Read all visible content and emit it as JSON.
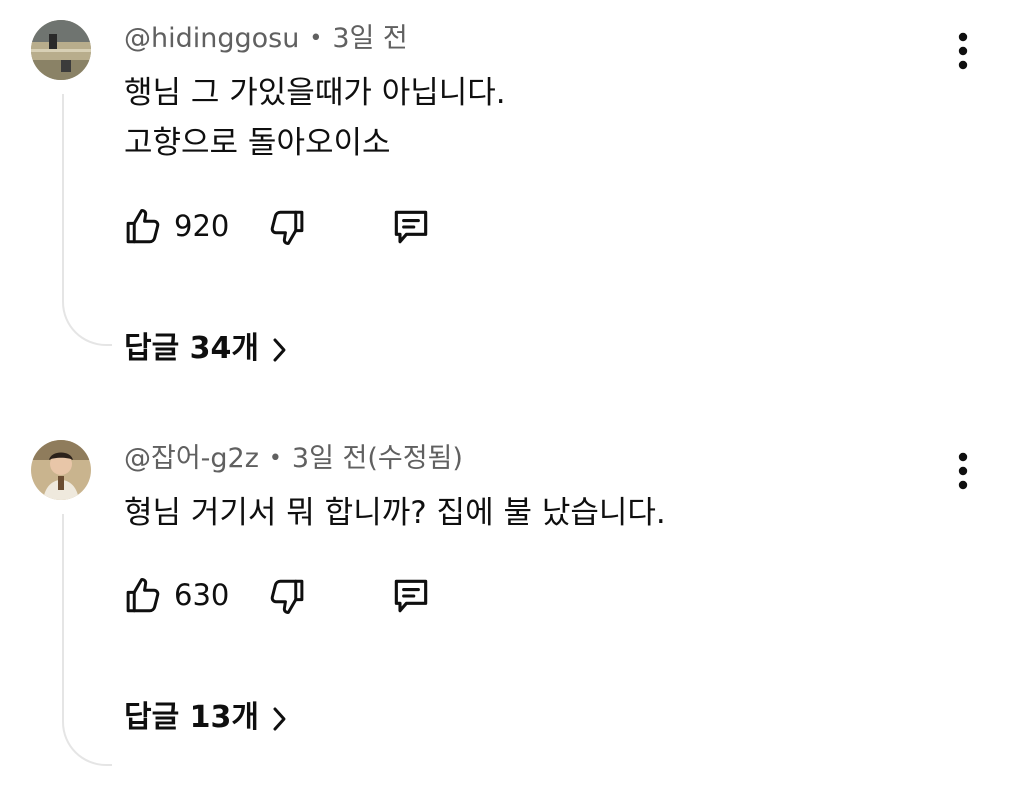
{
  "comments": [
    {
      "handle": "@hidinggosu",
      "separator": "•",
      "time": "3일 전",
      "lines": [
        "행님 그 가있을때가 아닙니다.",
        "고향으로 돌아오이소"
      ],
      "likes": "920",
      "replies_label": "답글 34개"
    },
    {
      "handle": "@잡어-g2z",
      "separator": "•",
      "time": "3일 전(수정됨)",
      "lines": [
        "형님 거기서 뭐 합니까? 집에 불 났습니다."
      ],
      "likes": "630",
      "replies_label": "답글 13개"
    }
  ],
  "icons": {
    "like": "thumbs-up-icon",
    "dislike": "thumbs-down-icon",
    "reply": "reply-icon",
    "more": "more-vertical-icon",
    "chevron": "chevron-right-icon"
  },
  "colors": {
    "text": "#0f0f0f",
    "meta": "#606060",
    "thread_line": "#e5e5e5",
    "background": "#ffffff"
  }
}
